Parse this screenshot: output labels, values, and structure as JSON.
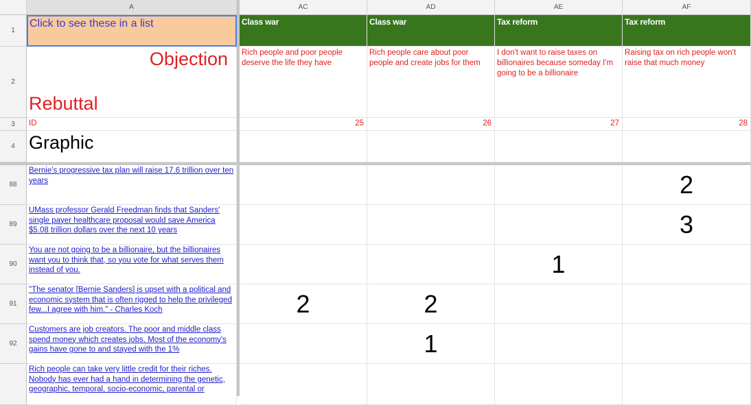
{
  "columns": {
    "row_header": "",
    "a": "A",
    "ac": "AC",
    "ad": "AD",
    "ae": "AE",
    "af": "AF"
  },
  "frozen_rows": [
    {
      "num": "1",
      "a": "Click to see these in a list",
      "ac": "Class war",
      "ad": "Class war",
      "ae": "Tax reform",
      "af": "Tax reform"
    },
    {
      "num": "2",
      "a_objection": "Objection",
      "a_rebuttal": "Rebuttal",
      "ac": "Rich people and poor people deserve the life they have",
      "ad": "Rich people care about poor people and create jobs for them",
      "ae": "I don't want to raise taxes on billionaires because someday I'm going to be a billionaire",
      "af": "Raising tax on rich people won't raise that much money"
    },
    {
      "num": "3",
      "a": "ID",
      "ac": "25",
      "ad": "26",
      "ae": "27",
      "af": "28"
    },
    {
      "num": "4",
      "a": "Graphic"
    }
  ],
  "rows": [
    {
      "num": "88",
      "a": "Bernie's progressive tax plan will raise 17.6 trillion over ten years",
      "ac": "",
      "ad": "",
      "ae": "",
      "af": "2"
    },
    {
      "num": "89",
      "a": "UMass professor Gerald Freedman finds that Sanders' single payer healthcare proposal would save America $5.08 trillion dollars over the next 10 years",
      "ac": "",
      "ad": "",
      "ae": "",
      "af": "3"
    },
    {
      "num": "90",
      "a": "You are not going to be a billionaire, but the billionaires want you to think that, so you vote for what serves them instead of you.",
      "ac": "",
      "ad": "",
      "ae": "1",
      "af": ""
    },
    {
      "num": "91",
      "a": "\"The senator [Bernie Sanders] is upset with a political and economic system that is often rigged to help the privileged few...I agree with him.\" - Charles Koch",
      "ac": "2",
      "ad": "2",
      "ae": "",
      "af": ""
    },
    {
      "num": "92",
      "a": "Customers are job creators. The poor and middle class spend money which creates jobs. Most of the economy's gains have gone to and stayed with the 1%",
      "ac": "",
      "ad": "1",
      "ae": "",
      "af": ""
    },
    {
      "num": "",
      "a": "Rich people can take very little credit for their riches. Nobody has ever had a hand in determining the genetic, geographic, temporal, socio-economic, parental or",
      "ac": "",
      "ad": "",
      "ae": "",
      "af": ""
    }
  ],
  "colors": {
    "header_green": "#38761d",
    "selected_fill": "#f9cb9c",
    "red_text": "#e02020",
    "link_blue": "#1c1cc8"
  }
}
